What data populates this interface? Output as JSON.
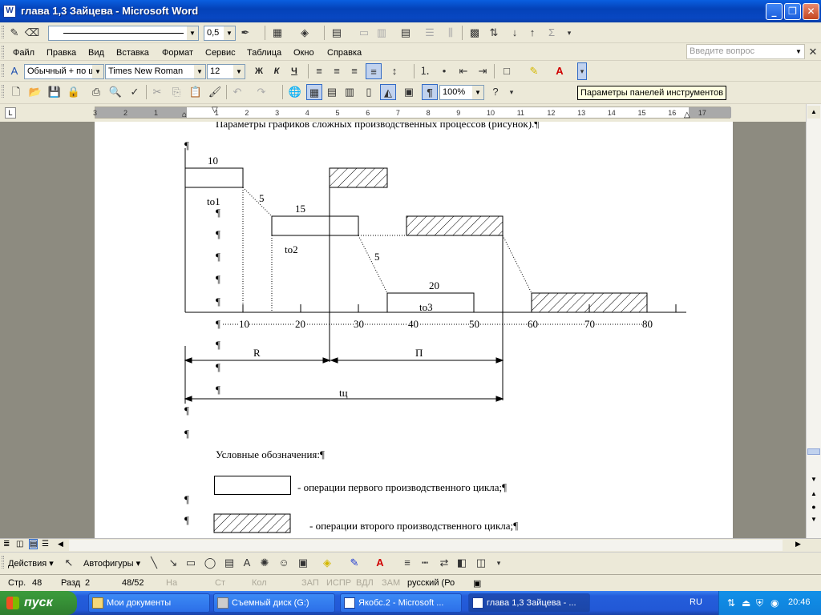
{
  "window": {
    "title": "глава 1,3 Зайцева - Microsoft Word",
    "app_icon": "W",
    "minimize_glyph": "_",
    "maximize_glyph": "❐",
    "close_glyph": "✕"
  },
  "drawing_toolbar_top": {
    "line_width": "0,5"
  },
  "menu": {
    "items": [
      "Файл",
      "Правка",
      "Вид",
      "Вставка",
      "Формат",
      "Сервис",
      "Таблица",
      "Окно",
      "Справка"
    ],
    "question_placeholder": "Введите вопрос"
  },
  "formatting": {
    "style": "Обычный + по ш",
    "font": "Times New Roman",
    "size": "12",
    "bold": "Ж",
    "italic": "К",
    "underline": "Ч"
  },
  "standard": {
    "zoom": "100%"
  },
  "tooltip": "Параметры панелей инструментов",
  "ruler": {
    "numbers": [
      "3",
      "2",
      "1",
      "1",
      "2",
      "3",
      "4",
      "5",
      "6",
      "7",
      "8",
      "9",
      "10",
      "11",
      "12",
      "13",
      "14",
      "15",
      "16",
      "17"
    ]
  },
  "document": {
    "heading": "Параметры графиков сложных производственных процессов (рисунок).",
    "chart_labels": {
      "op1_duration": "10",
      "op1_t": "tо1",
      "gap1": "5",
      "op2_duration": "15",
      "op2_t": "tо2",
      "gap2": "5",
      "op3_duration": "20",
      "op3_t": "tо3",
      "axis_ticks": [
        "10",
        "20",
        "30",
        "40",
        "50",
        "60",
        "70",
        "80"
      ],
      "interval_R": "R",
      "interval_P": "П",
      "interval_total": "tц"
    },
    "legend_title": "Условные обозначения:",
    "legend_plain": "- операции первого производственного цикла;",
    "legend_hatched": "- операции второго производственного цикла;",
    "pilcrow": "¶"
  },
  "draw_bar": {
    "actions": "Действия",
    "autoshapes": "Автофигуры"
  },
  "status": {
    "page": "Стр.",
    "page_num": "48",
    "section": "Разд",
    "section_num": "2",
    "pages": "48/52",
    "at": "На",
    "line": "Ст",
    "col": "Кол",
    "rec": "ЗАП",
    "trk": "ИСПР",
    "ext": "ВДЛ",
    "ovr": "ЗАМ",
    "language": "русский (Ро"
  },
  "taskbar": {
    "start": "пуск",
    "tasks": [
      "Мои документы",
      "Съемный диск (G:)",
      "Якобс.2 - Microsoft ...",
      "глава 1,3 Зайцева - ..."
    ],
    "lang": "RU",
    "time": "20:46"
  }
}
